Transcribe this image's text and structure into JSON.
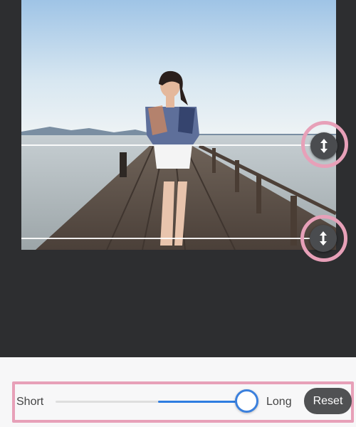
{
  "editor": {
    "photo_alt": "Woman walking on wooden pier"
  },
  "handles": {
    "top_icon": "vertical-arrows-icon",
    "bottom_icon": "vertical-arrows-icon"
  },
  "controls": {
    "short_label": "Short",
    "long_label": "Long",
    "reset_label": "Reset",
    "slider_value_fraction": 0.91
  },
  "colors": {
    "accent_blue": "#2f7de1",
    "highlight_pink": "#e7a0b8",
    "dark_background": "#2d2e30"
  }
}
